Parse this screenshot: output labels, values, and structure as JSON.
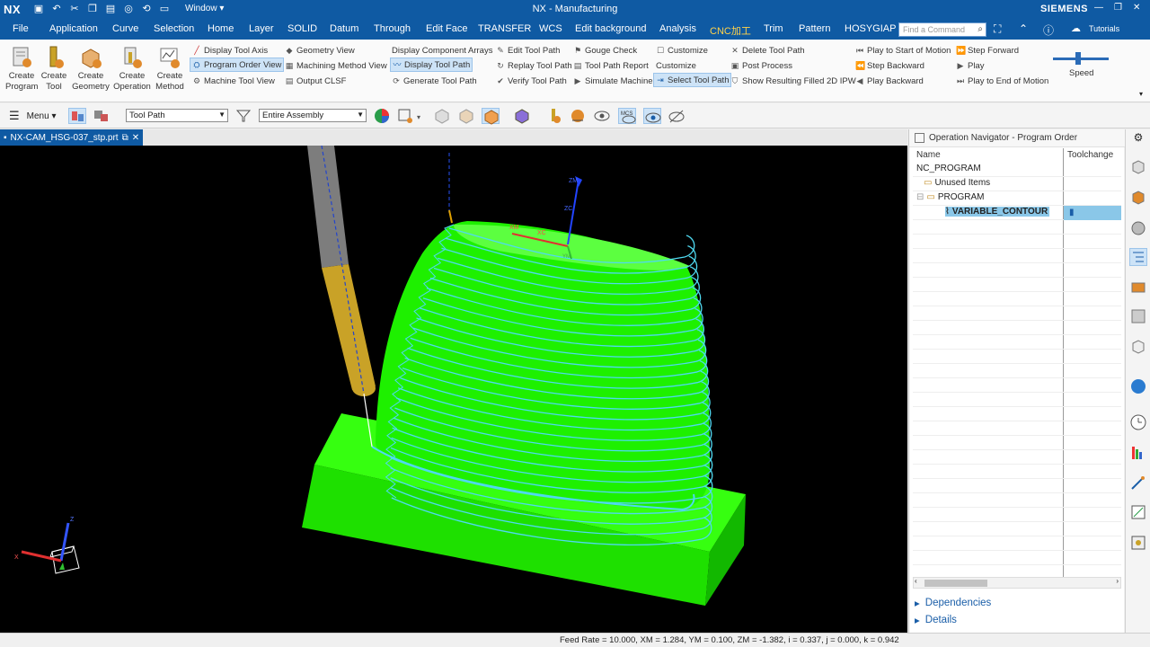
{
  "titlebar": {
    "logo": "NX",
    "window_menu": "Window ▾",
    "title": "NX - Manufacturing",
    "brand": "SIEMENS"
  },
  "menubar": {
    "items": [
      "File",
      "Application",
      "Curve",
      "Selection",
      "Home",
      "Layer",
      "SOLID",
      "Datum",
      "Through",
      "Edit Face",
      "TRANSFER",
      "WCS",
      "Edit background",
      "Analysis",
      "CNC加工",
      "Trim",
      "Pattern",
      "HOSYGIAP"
    ],
    "search_placeholder": "Find a Command",
    "tutorials": "Tutorials"
  },
  "ribbon": {
    "big_buttons": [
      {
        "l1": "Create",
        "l2": "Program",
        "icon": "create-program-icon"
      },
      {
        "l1": "Create",
        "l2": "Tool",
        "icon": "create-tool-icon"
      },
      {
        "l1": "Create",
        "l2": "Geometry",
        "icon": "create-geometry-icon"
      },
      {
        "l1": "Create",
        "l2": "Operation",
        "icon": "create-operation-icon"
      },
      {
        "l1": "Create",
        "l2": "Method",
        "icon": "create-method-icon"
      }
    ],
    "small_buttons": [
      "Display Tool Axis",
      "Program Order View",
      "Machine Tool View",
      "Geometry View",
      "Machining Method View",
      "Output CLSF",
      "Display Component Arrays",
      "Display Tool Path",
      "Generate Tool Path",
      "Edit Tool Path",
      "Replay Tool Path",
      "Verify Tool Path",
      "Gouge Check",
      "Tool Path Report",
      "Simulate Machine",
      "Customize",
      "Customize",
      "Select Tool Path",
      "Delete Tool Path",
      "Post Process",
      "Show Resulting Filled 2D IPW",
      "Play to Start of Motion",
      "Step Backward",
      "Play Backward",
      "Step Forward",
      "Play",
      "Play to End of Motion"
    ],
    "speed_label": "Speed",
    "speed_level": 0.45
  },
  "toolbar": {
    "menu_label": "Menu ▾",
    "filter_value": "Tool Path",
    "scope_value": "Entire Assembly"
  },
  "document_tab": {
    "label": "NX-CAM_HSG-037_stp.prt"
  },
  "viewport": {
    "wcs_labels": {
      "zm": "ZM",
      "zc": "ZC",
      "xm": "XM",
      "xc": "XC",
      "ym": "YM"
    },
    "triad_labels": {
      "z": "Z",
      "x": "X"
    }
  },
  "navigator": {
    "title": "Operation Navigator - Program Order",
    "columns": [
      "Name",
      "Toolchange"
    ],
    "tree": [
      {
        "label": "NC_PROGRAM",
        "level": 0
      },
      {
        "label": "Unused Items",
        "level": 1
      },
      {
        "label": "PROGRAM",
        "level": 1
      },
      {
        "label": "VARIABLE_CONTOUR",
        "level": 2,
        "selected": true
      }
    ],
    "sections": [
      "Dependencies",
      "Details"
    ]
  },
  "status": {
    "text": "Feed Rate = 10.000, XM = 1.284, YM = 0.100, ZM = -1.382, i = 0.337, j = 0.000, k = 0.942"
  },
  "colors": {
    "title_blue": "#0f5aa3",
    "part_green": "#1eff00",
    "toolpath_cyan": "#4fd9f0",
    "tool_gold": "#c9a227",
    "selection_blue": "#8ac7e8"
  }
}
